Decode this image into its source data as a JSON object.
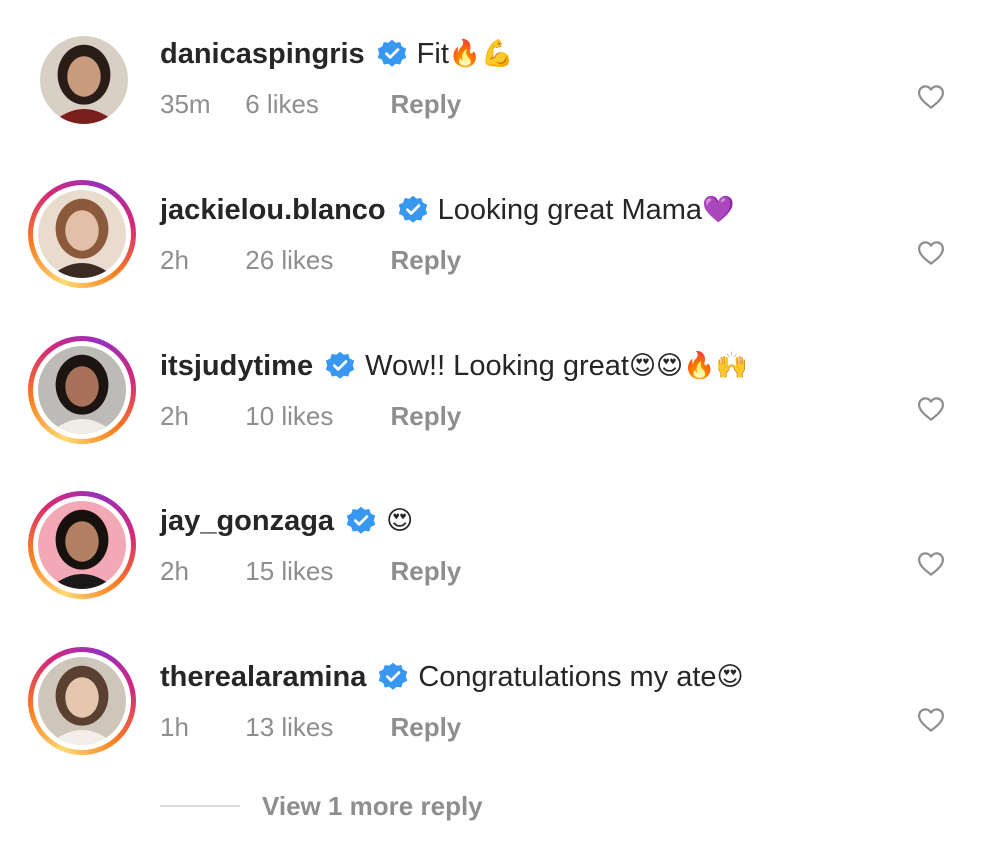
{
  "comments": [
    {
      "username": "danicaspingris",
      "text": "Fit",
      "emojis": "🔥💪",
      "time": "35m",
      "likes": "6 likes",
      "reply": "Reply",
      "story_ring": false,
      "avatar_colors": {
        "bg": "#d8d0c4",
        "hair": "#2a1c16",
        "skin": "#c99b7e",
        "cloth": "#7a1e1e"
      }
    },
    {
      "username": "jackielou.blanco",
      "text": "Looking great Mama",
      "emojis": "💜",
      "time": "2h",
      "likes": "26 likes",
      "reply": "Reply",
      "story_ring": true,
      "avatar_colors": {
        "bg": "#e9dccf",
        "hair": "#8b5a3c",
        "skin": "#e2bfa6",
        "cloth": "#3a2a22"
      }
    },
    {
      "username": "itsjudytime",
      "text": "Wow!! Looking great",
      "emojis": "😍😍🔥🙌",
      "time": "2h",
      "likes": "10 likes",
      "reply": "Reply",
      "story_ring": true,
      "avatar_colors": {
        "bg": "#bdbbb8",
        "hair": "#1c1410",
        "skin": "#a8725a",
        "cloth": "#f0ece6"
      }
    },
    {
      "username": "jay_gonzaga",
      "text": "",
      "emojis": "😍",
      "time": "2h",
      "likes": "15 likes",
      "reply": "Reply",
      "story_ring": true,
      "avatar_colors": {
        "bg": "#f3a8b6",
        "hair": "#17110e",
        "skin": "#b48064",
        "cloth": "#1a1a1a"
      }
    },
    {
      "username": "therealaramina",
      "text": "Congratulations my ate",
      "emojis": "😍",
      "time": "1h",
      "likes": "13 likes",
      "reply": "Reply",
      "story_ring": true,
      "avatar_colors": {
        "bg": "#cfc6bb",
        "hair": "#5a4030",
        "skin": "#e5c7ae",
        "cloth": "#f3efe8"
      }
    }
  ],
  "view_more": "View 1 more reply",
  "icons": {
    "verified": "verified-badge-icon",
    "like": "heart-outline-icon"
  },
  "colors": {
    "verified": "#3897f0",
    "muted": "#8e8e8e",
    "text": "#262626"
  }
}
